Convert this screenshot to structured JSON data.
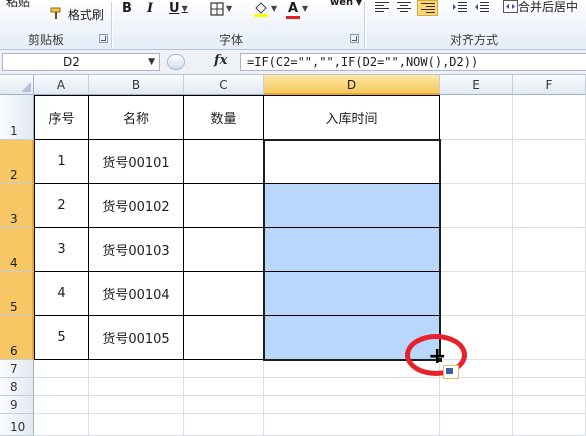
{
  "ribbon": {
    "paste_partial": "粘贴",
    "format_painter": "格式刷",
    "bold": "B",
    "italic": "I",
    "underline": "U",
    "wen": "wén",
    "wrap_merge": "合并后居中",
    "groups": {
      "clipboard": "剪贴板",
      "font": "字体",
      "alignment": "对齐方式"
    },
    "colors": {
      "highlight": "#ffff00",
      "font_color": "#e02020"
    }
  },
  "formula_bar": {
    "name_box": "D2",
    "fx": "fx",
    "formula": "=IF(C2=\"\",\"\",IF(D2=\"\",NOW(),D2))"
  },
  "sheet": {
    "columns": [
      "A",
      "B",
      "C",
      "D",
      "E",
      "F"
    ],
    "rows": [
      "1",
      "2",
      "3",
      "4",
      "5",
      "6",
      "7",
      "8",
      "9",
      "10"
    ],
    "headers": {
      "a": "序号",
      "b": "名称",
      "c": "数量",
      "d": "入库时间"
    },
    "data": [
      {
        "index": "1",
        "name": "货号00101",
        "qty": "",
        "time": ""
      },
      {
        "index": "2",
        "name": "货号00102",
        "qty": "",
        "time": ""
      },
      {
        "index": "3",
        "name": "货号00103",
        "qty": "",
        "time": ""
      },
      {
        "index": "4",
        "name": "货号00104",
        "qty": "",
        "time": ""
      },
      {
        "index": "5",
        "name": "货号00105",
        "qty": "",
        "time": ""
      }
    ],
    "selection_color": "#b8d7fb",
    "annotation_color": "#e8202a"
  }
}
